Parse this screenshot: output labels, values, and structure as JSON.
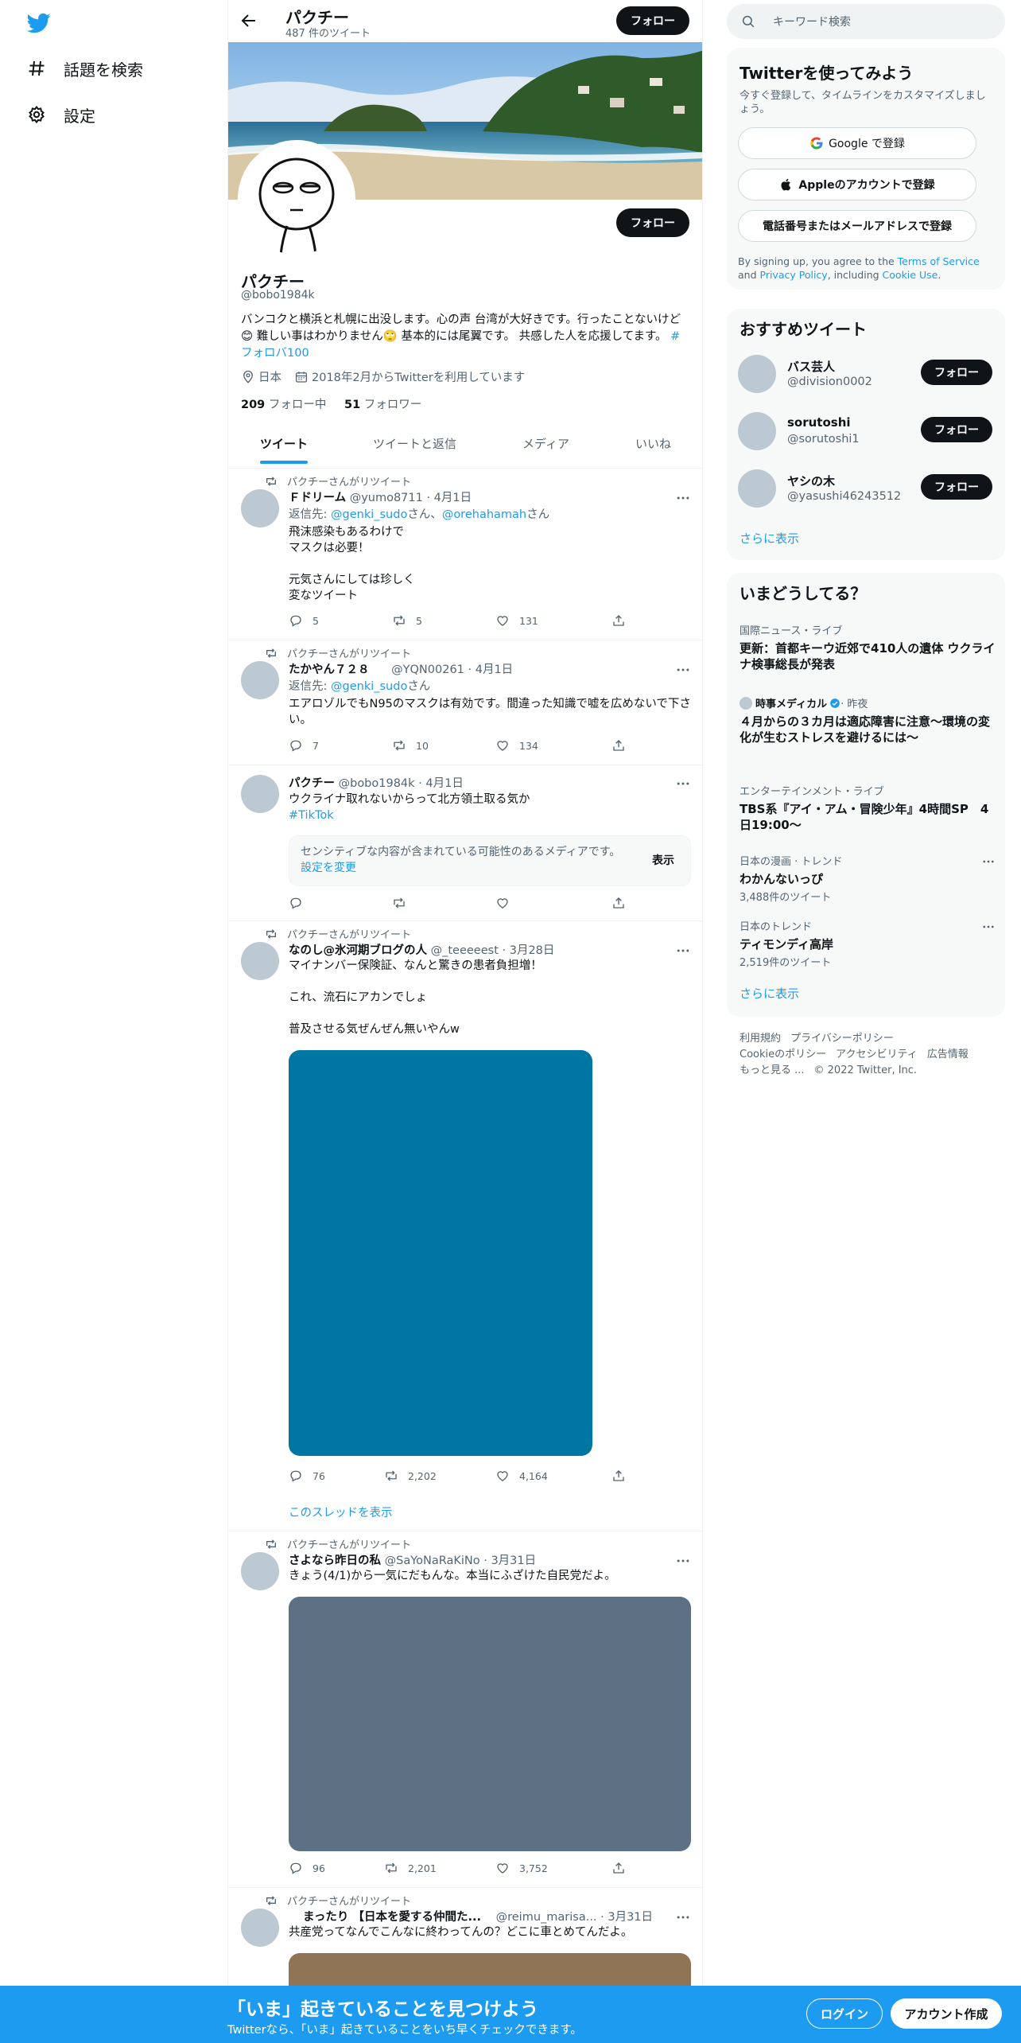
{
  "nav": {
    "explore": "話題を検索",
    "settings": "設定"
  },
  "header": {
    "name": "パクチー",
    "tweet_count": "487 件のツイート",
    "follow": "フォロー"
  },
  "profile": {
    "name": "パクチー",
    "handle": "@bobo1984k",
    "bio_1": "バンコクと横浜と札幌に出没します。心の声 台湾が大好きです。行ったことないけど😊 難しい事はわかりません🙄 基本的には尾翼です。 共感した人を応援してます。 ",
    "bio_hashtag": "#フォロバ100",
    "location": "日本",
    "joined": "2018年2月からTwitterを利用しています",
    "following_count": "209",
    "following_label": " フォロー中",
    "followers_count": "51",
    "followers_label": " フォロワー",
    "follow": "フォロー"
  },
  "tabs": [
    "ツイート",
    "ツイートと返信",
    "メディア",
    "いいね"
  ],
  "tweets": [
    {
      "rt": "パクチーさんがリツイート",
      "name": "Ｆドリーム",
      "meta": "@yumo8711 · 4月1日",
      "reply_prefix": "返信先: ",
      "reply_to_1": "@genki_sudo",
      "reply_mid": "さん、",
      "reply_to_2": "@orehahamah",
      "reply_suffix": "さん",
      "text": "飛沫感染もあるわけで\nマスクは必要！\n\n元気さんにしては珍しく\n変なツイート",
      "replies": "5",
      "retweets": "5",
      "likes": "131"
    },
    {
      "rt": "パクチーさんがリツイート",
      "name": "たかやん７２８",
      "meta": "@YQN00261 · 4月1日",
      "reply_prefix": "返信先: ",
      "reply_to_1": "@genki_sudo",
      "reply_suffix": "さん",
      "text": "エアロゾルでもN95のマスクは有効です。間違った知識で嘘を広めないで下さい。",
      "replies": "7",
      "retweets": "10",
      "likes": "134"
    },
    {
      "name": "パクチー",
      "meta": "@bobo1984k · 4月1日",
      "text": "ウクライナ取れないからって北方領土取る気か",
      "hashtag": "#TikTok",
      "sensitive_text": "センシティブな内容が含まれている可能性のあるメディアです。",
      "sensitive_link": "設定を変更",
      "sensitive_show": "表示"
    },
    {
      "rt": "パクチーさんがリツイート",
      "name": "なのし@氷河期ブログの人",
      "meta": "@_teeeeest · 3月28日",
      "text": "マイナンバー保険証、なんと驚きの患者負担増！\n\nこれ、流石にアカンでしょ\n\n普及させる気ぜんぜん無いやんw",
      "replies": "76",
      "retweets": "2,202",
      "likes": "4,164",
      "thread": "このスレッドを表示",
      "media_color": "#0077a3"
    },
    {
      "rt": "パクチーさんがリツイート",
      "name": "さよなら昨日の私",
      "meta": "@SaYoNaRaKiNo · 3月31日",
      "text": "きょう(4/1)から一気にだもんな。本当にふざけた自民党だよ。",
      "replies": "96",
      "retweets": "2,201",
      "likes": "3,752",
      "media_color": "#5e7184"
    },
    {
      "rt": "パクチーさんがリツイート",
      "name": "まったり 【日本を愛する仲間た...",
      "meta": "@reimu_marisa... · 3月31日",
      "text": "共産党ってなんでこんなに終わってんの？どこに車とめてんだよ。",
      "media_color": "#8f7556"
    }
  ],
  "search": {
    "placeholder": "キーワード検索"
  },
  "signup_box": {
    "title": "Twitterを使ってみよう",
    "subtitle": "今すぐ登録して、タイムラインをカスタマイズしましょう。",
    "google": "Google で登録",
    "apple": "Appleのアカウントで登録",
    "phone": "電話番号またはメールアドレスで登録",
    "legal_1": "By signing up, you agree to the ",
    "terms": "Terms of Service",
    "legal_2": " and ",
    "privacy": "Privacy Policy",
    "legal_3": ", including ",
    "cookie": "Cookie Use",
    "legal_4": "."
  },
  "recommend": {
    "title": "おすすめツイート",
    "users": [
      {
        "name": "バス芸人",
        "handle": "@division0002",
        "button": "フォロー"
      },
      {
        "name": "sorutoshi",
        "handle": "@sorutoshi1",
        "button": "フォロー"
      },
      {
        "name": "ヤシの木",
        "handle": "@yasushi46243512",
        "button": "フォロー"
      }
    ],
    "more": "さらに表示"
  },
  "trends": {
    "title": "いまどうしてる？",
    "items": [
      {
        "meta": "国際ニュース・ライブ",
        "title": "更新：首都キーウ近郊で410人の遺体 ウクライナ検事総長が発表"
      },
      {
        "meta_source": "時事メディカル",
        "meta_time": " · 昨夜",
        "title": "４月からの３カ月は適応障害に注意～環境の変化が生むストレスを避けるには～"
      },
      {
        "meta": "エンターテインメント・ライブ",
        "title": "TBS系『アイ・アム・冒険少年』4時間SP　4日19:00～"
      },
      {
        "meta": "日本の漫画 · トレンド",
        "title": "わかんないっぴ",
        "count": "3,488件のツイート"
      },
      {
        "meta": "日本のトレンド",
        "title": "ティモンディ高岸",
        "count": "2,519件のツイート"
      }
    ],
    "more": "さらに表示"
  },
  "footer": {
    "links_1": [
      "利用規約",
      "プライバシーポリシー"
    ],
    "links_2": [
      "Cookieのポリシー",
      "アクセシビリティ",
      "広告情報"
    ],
    "more": "もっと見る ...",
    "copyright": "© 2022 Twitter, Inc."
  },
  "bottom_bar": {
    "title": "「いま」起きていることを見つけよう",
    "subtitle": "Twitterなら、「いま」起きていることをいち早くチェックできます。",
    "login": "ログイン",
    "signup": "アカウント作成"
  },
  "colors": {
    "accent": "#1d9bf0",
    "text": "#0f1419",
    "muted": "#536471"
  }
}
